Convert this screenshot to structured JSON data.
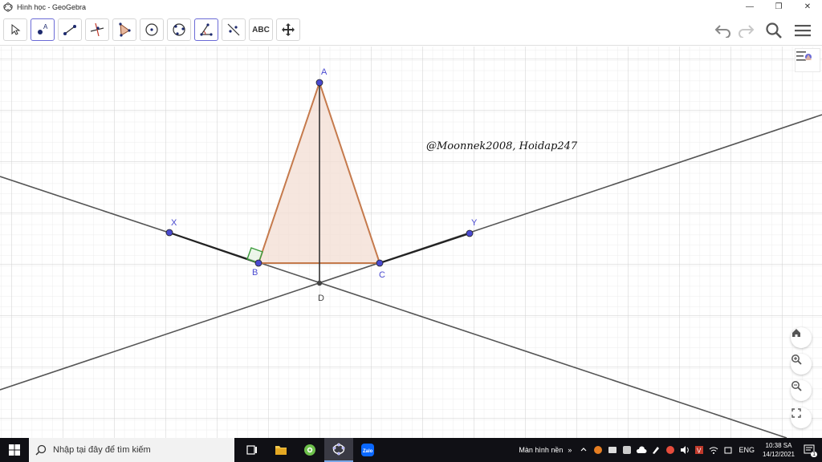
{
  "window": {
    "title": "Hình học - GeoGebra",
    "controls": {
      "minimize": "—",
      "maximize": "❐",
      "close": "✕"
    }
  },
  "toolbar": {
    "tools": [
      {
        "name": "move-tool",
        "icon": "cursor-arrow-icon"
      },
      {
        "name": "point-tool",
        "icon": "point-a-icon",
        "active": true
      },
      {
        "name": "segment-tool",
        "icon": "segment-icon"
      },
      {
        "name": "perpendicular-line-tool",
        "icon": "perpendicular-icon"
      },
      {
        "name": "polygon-tool",
        "icon": "polygon-icon"
      },
      {
        "name": "circle-center-point-tool",
        "icon": "circle-center-icon"
      },
      {
        "name": "circle-three-points-tool",
        "icon": "circle-three-points-icon"
      },
      {
        "name": "angle-tool",
        "icon": "angle-icon",
        "active": true
      },
      {
        "name": "reflect-tool",
        "icon": "reflect-icon"
      },
      {
        "name": "text-tool",
        "label": "ABC"
      },
      {
        "name": "move-graphics-view-tool",
        "icon": "move-arrows-icon"
      }
    ],
    "right": [
      "undo-icon",
      "redo-icon",
      "search-icon",
      "menu-icon"
    ]
  },
  "graphics": {
    "points": {
      "A": "A",
      "B": "B",
      "C": "C",
      "D": "D",
      "X": "X",
      "Y": "Y"
    },
    "watermark": "@Moonnek2008, Hoidap247",
    "colors": {
      "triangle_fill": "#f3ddd3",
      "triangle_stroke": "#c57a4c",
      "point": "#4a4ad0",
      "line": "#444444",
      "right_angle": "#3a9a3a"
    }
  },
  "taskbar": {
    "search_placeholder": "Nhập tại đây để tìm kiếm",
    "desktop_label": "Màn hình nền",
    "language": "ENG",
    "time": "10:38 SA",
    "date": "14/12/2021",
    "notification_count": "1"
  }
}
